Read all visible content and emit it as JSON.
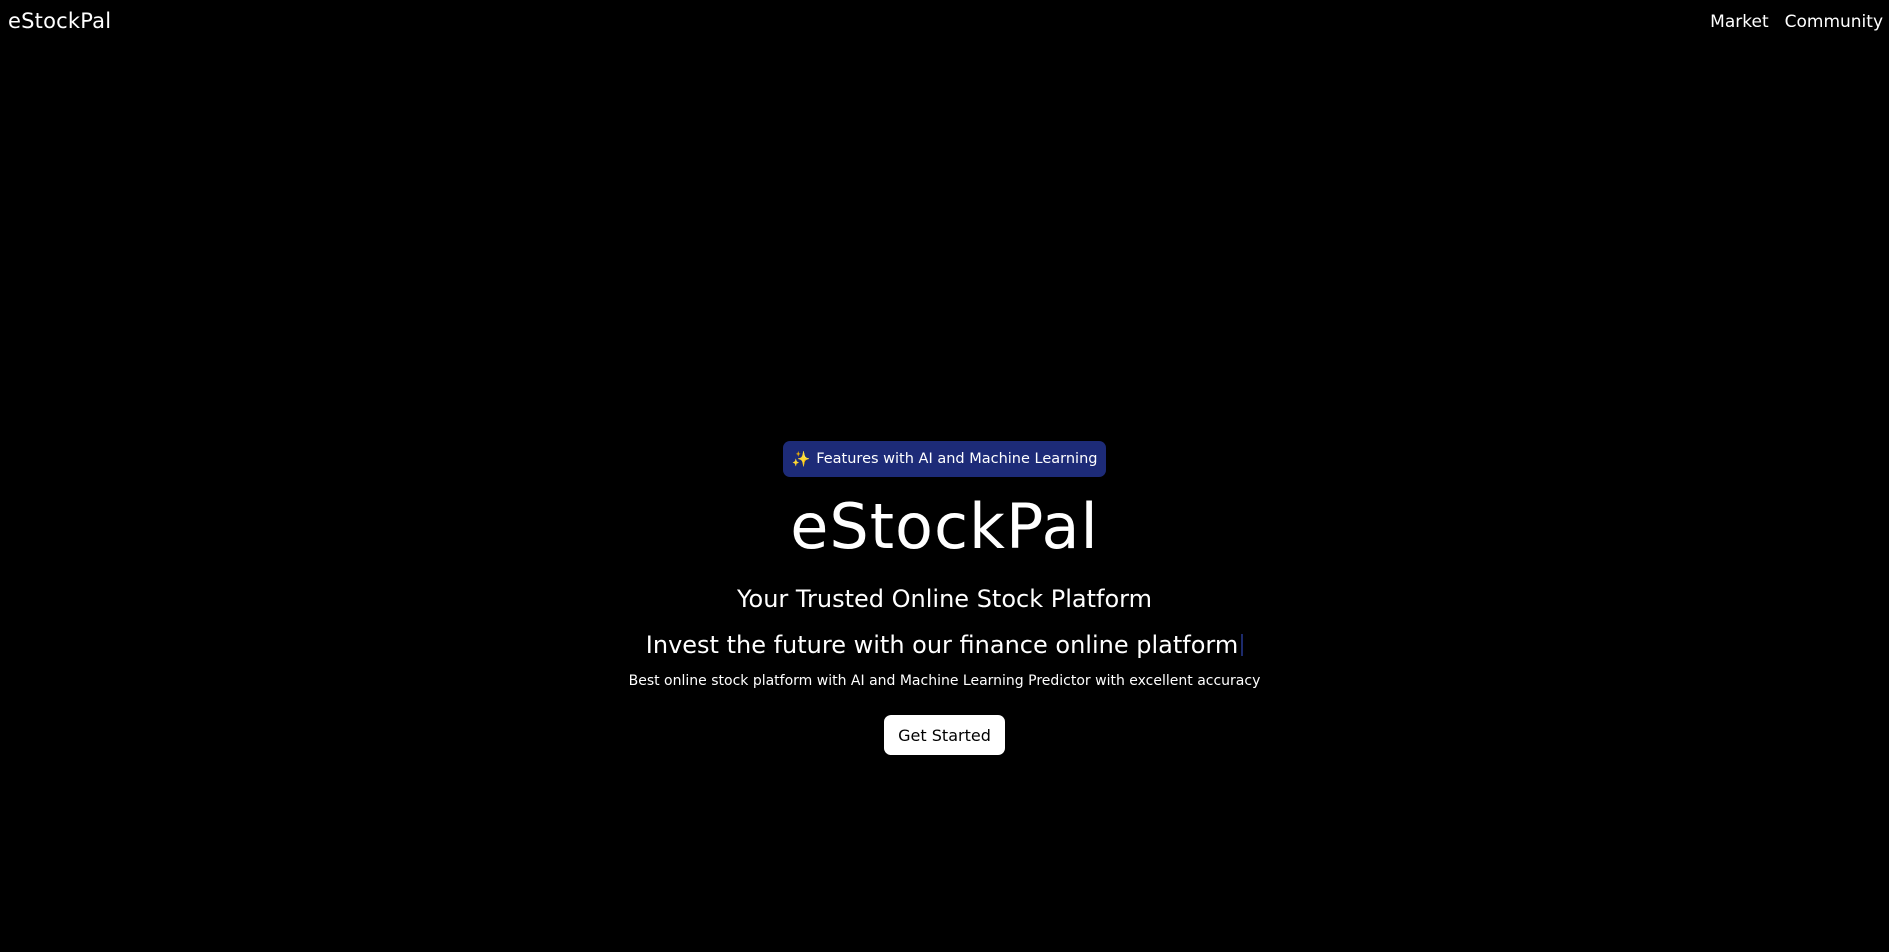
{
  "navbar": {
    "brand": "eStockPal",
    "links": [
      "Market",
      "Community"
    ]
  },
  "hero": {
    "badge_icon": "sparkles-icon",
    "badge_glyph": "✨",
    "badge_label": "Features with AI and Machine Learning",
    "title": "eStockPal",
    "subtitle": "Your Trusted Online Stock Platform",
    "tagline": "Invest the future with our finance online platform",
    "description": "Best online stock platform with AI and Machine Learning Predictor with excellent accuracy",
    "cta_label": "Get Started"
  },
  "colors": {
    "background": "#000000",
    "text": "#ffffff",
    "badge_background": "#1d2b78",
    "button_background": "#ffffff",
    "button_text": "#000000"
  }
}
